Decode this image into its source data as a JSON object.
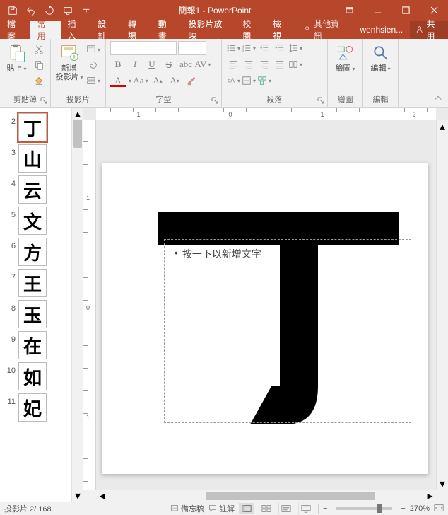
{
  "title": "簡報1 - PowerPoint",
  "user": "wenhsien...",
  "share_label": "共用",
  "tell_me": "其他資訊",
  "tabs": {
    "file": "檔案",
    "home": "常用",
    "insert": "插入",
    "design": "設計",
    "transitions": "轉場",
    "animations": "動畫",
    "slideshow": "投影片放映",
    "review": "校閱",
    "view": "檢視"
  },
  "groups": {
    "clipboard": {
      "label": "剪貼簿",
      "paste": "貼上"
    },
    "slides": {
      "label": "投影片",
      "new_slide": "新增\n投影片"
    },
    "font": {
      "label": "字型"
    },
    "paragraph": {
      "label": "段落"
    },
    "drawing": {
      "label": "繪圖"
    },
    "editing": {
      "label": "編輯"
    }
  },
  "thumbs": [
    {
      "n": 2,
      "ch": "丁",
      "selected": true
    },
    {
      "n": 3,
      "ch": "山"
    },
    {
      "n": 4,
      "ch": "云"
    },
    {
      "n": 5,
      "ch": "文"
    },
    {
      "n": 6,
      "ch": "方"
    },
    {
      "n": 7,
      "ch": "王"
    },
    {
      "n": 8,
      "ch": "玉"
    },
    {
      "n": 9,
      "ch": "在"
    },
    {
      "n": 10,
      "ch": "如"
    },
    {
      "n": 11,
      "ch": "妃"
    }
  ],
  "slide": {
    "placeholder": "按一下以新增文字",
    "big_char": "丁"
  },
  "status": {
    "slide_counter": "投影片 2/ 168",
    "notes": "備忘稿",
    "comments": "註解",
    "zoom": "270%"
  },
  "ruler": {
    "h": [
      "1",
      "0",
      "1",
      "2"
    ],
    "v": [
      "1",
      "0",
      "1"
    ]
  }
}
